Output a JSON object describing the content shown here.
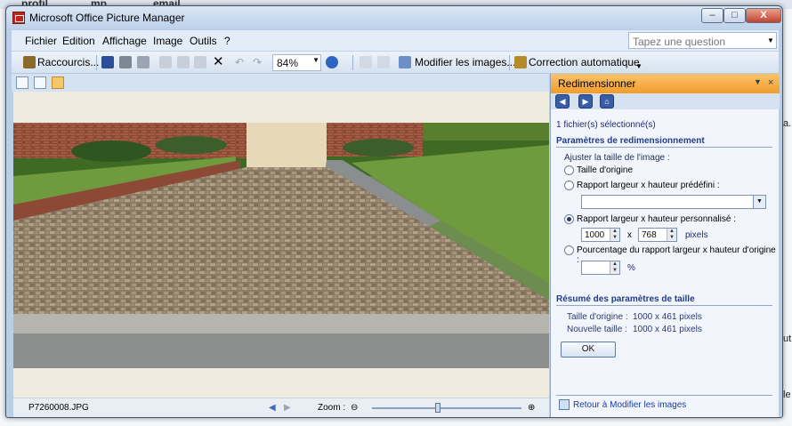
{
  "background": {
    "tabs": [
      "profil",
      "mp",
      "email"
    ],
    "right_edge_chars": [
      "a.",
      "ut",
      "le"
    ]
  },
  "window": {
    "title": "Microsoft Office Picture Manager",
    "min_label": "–",
    "max_label": "□",
    "close_label": "X"
  },
  "menu": {
    "items": [
      "Fichier",
      "Edition",
      "Affichage",
      "Image",
      "Outils",
      "?"
    ],
    "ask_placeholder": "Tapez une question"
  },
  "toolbar": {
    "shortcuts_label": "Raccourcis...",
    "zoom_value": "84%",
    "edit_images_label": "Modifier les images...",
    "auto_correct_label": "Correction automatique"
  },
  "status": {
    "filename": "P7260008.JPG",
    "zoom_label": "Zoom :"
  },
  "pane": {
    "title": "Redimensionner",
    "selected_count": "1 fichier(s) sélectionné(s)",
    "section_params": "Paramètres de redimensionnement",
    "adjust_label": "Ajuster la taille de l'image :",
    "opt_original": "Taille d'origine",
    "opt_predefined": "Rapport largeur x hauteur prédéfini :",
    "opt_custom": "Rapport largeur x hauteur personnalisé :",
    "width_value": "1000",
    "times": "x",
    "height_value": "768",
    "pixels": "pixels",
    "opt_percent": "Pourcentage du rapport largeur x hauteur d'origine :",
    "percent_value": "",
    "percent_sign": "%",
    "section_summary": "Résumé des paramètres de taille",
    "original_size_label": "Taille d'origine :",
    "original_size_value": "1000 x 461 pixels",
    "new_size_label": "Nouvelle taille :",
    "new_size_value": "1000 x 461 pixels",
    "ok_label": "OK",
    "back_link": "Retour à Modifier les images"
  },
  "colors": {
    "pane_header": "#f6a93d",
    "section_text": "#1f3c8a",
    "link": "#1a3d9c"
  }
}
